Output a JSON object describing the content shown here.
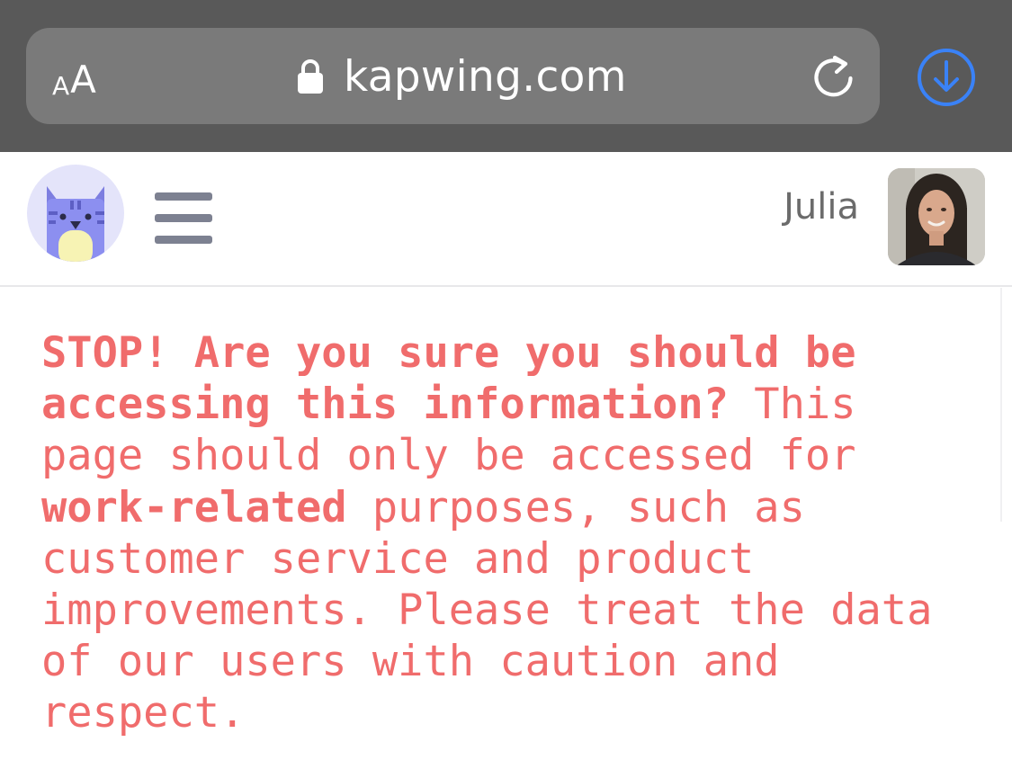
{
  "browser": {
    "text_size_button": {
      "small": "A",
      "large": "A"
    },
    "url": "kapwing.com",
    "icons": [
      "lock-icon",
      "reload-icon",
      "download-icon"
    ],
    "colors": {
      "bar": "#595959",
      "field": "#7a7a7a",
      "download_accent": "#3a82f7"
    }
  },
  "header": {
    "logo_icon": "kapwing-cat-logo",
    "menu_icon": "hamburger-menu-icon",
    "user_name": "Julia",
    "avatar": "user-avatar-photo"
  },
  "warning": {
    "headline": "STOP! Are you sure you should be accessing this information?",
    "text_1": " This page should only be accessed for ",
    "emphasis": "work-related",
    "text_2": " purposes, such as customer service and product improvements. Please treat the data of our users with caution and respect.",
    "color": "#f06c6c"
  }
}
